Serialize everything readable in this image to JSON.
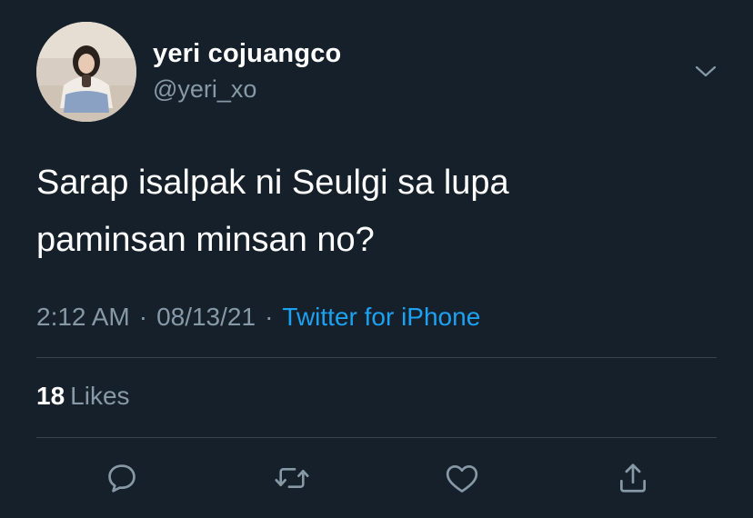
{
  "user": {
    "display_name": "yeri cojuangco",
    "handle": "@yeri_xo"
  },
  "tweet": {
    "text": "Sarap isalpak ni Seulgi sa lupa\npaminsan minsan no?",
    "time": "2:12 AM",
    "separator": "·",
    "date": "08/13/21",
    "source": "Twitter for iPhone"
  },
  "stats": {
    "likes_count": "18",
    "likes_label": "Likes"
  },
  "icons": {
    "more": "chevron-down-icon",
    "reply": "reply-icon",
    "retweet": "retweet-icon",
    "like": "heart-icon",
    "share": "share-icon"
  },
  "colors": {
    "background": "#15202b",
    "primary_text": "#ffffff",
    "secondary_text": "#8899a6",
    "link": "#1da1f2",
    "divider": "#38444d"
  }
}
